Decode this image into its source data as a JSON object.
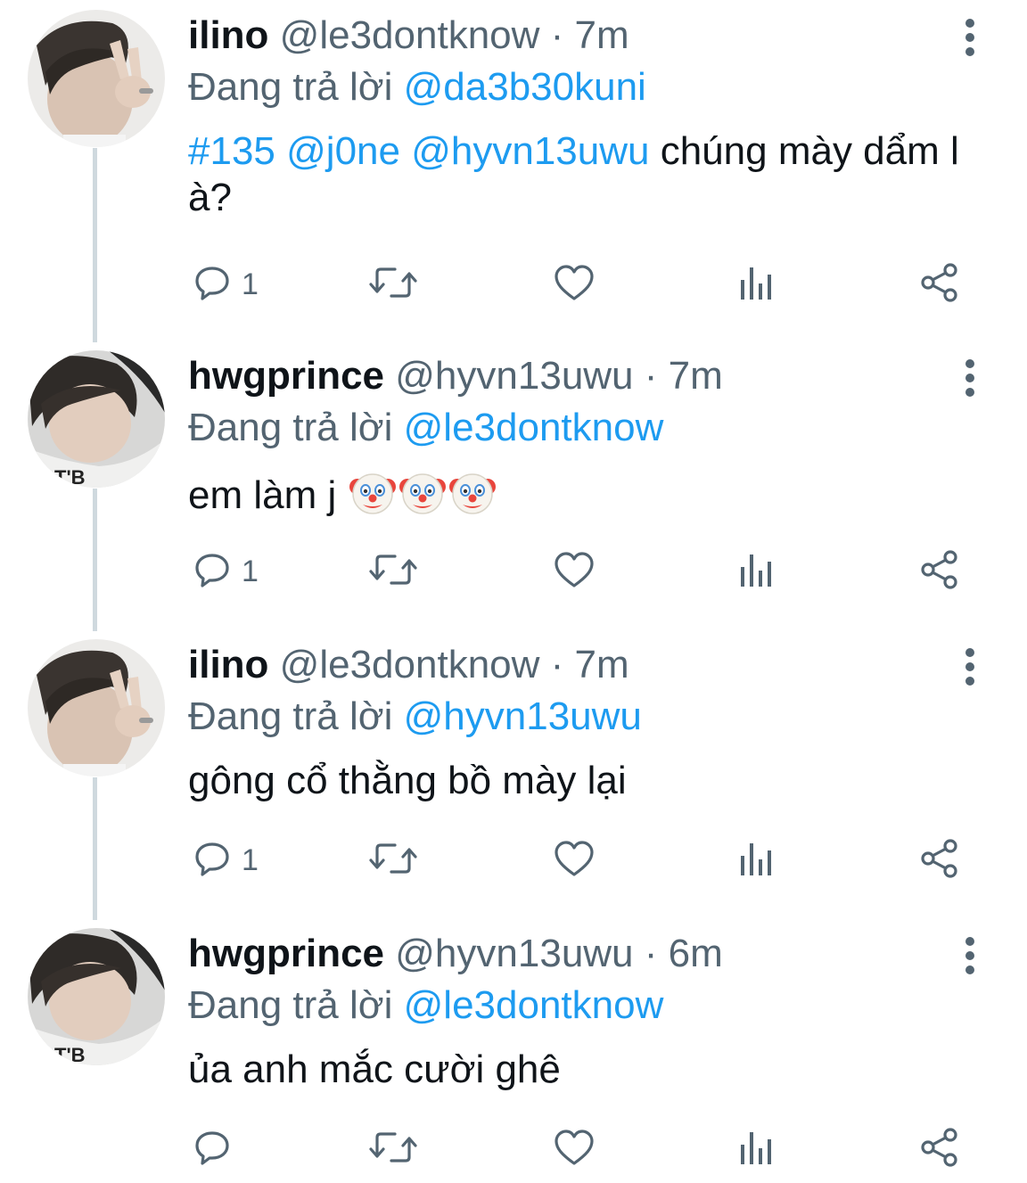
{
  "colors": {
    "link": "#1d9bf0",
    "secondary": "#536471",
    "text": "#0f1419",
    "thread_line": "#cfd9de"
  },
  "tweets": [
    {
      "name": "ilino",
      "handle": "@le3dontknow",
      "time": "· 7m",
      "reply_prefix": "Đang trả lời",
      "reply_to": "@da3b30kuni",
      "body_parts": [
        {
          "text": "#135",
          "link": true
        },
        {
          "text": " ",
          "link": false
        },
        {
          "text": "@j0ne",
          "link": true
        },
        {
          "text": " ",
          "link": false
        },
        {
          "text": "@hyvn13uwu",
          "link": true
        },
        {
          "text": " chúng mày dẩm l à?",
          "link": false
        }
      ],
      "reply_count": "1",
      "avatar_icon": "avatar-ilino"
    },
    {
      "name": "hwgprince",
      "handle": "@hyvn13uwu",
      "time": "· 7m",
      "reply_prefix": "Đang trả lời",
      "reply_to": "@le3dontknow",
      "body_parts": [
        {
          "text": "em làm j ",
          "link": false
        }
      ],
      "emoji": [
        "clown-face-emoji",
        "clown-face-emoji",
        "clown-face-emoji"
      ],
      "reply_count": "1",
      "avatar_icon": "avatar-hwgprince"
    },
    {
      "name": "ilino",
      "handle": "@le3dontknow",
      "time": "· 7m",
      "reply_prefix": "Đang trả lời",
      "reply_to": "@hyvn13uwu",
      "body_parts": [
        {
          "text": "gông cổ thằng bồ mày lại",
          "link": false
        }
      ],
      "reply_count": "1",
      "avatar_icon": "avatar-ilino"
    },
    {
      "name": "hwgprince",
      "handle": "@hyvn13uwu",
      "time": "· 6m",
      "reply_prefix": "Đang trả lời",
      "reply_to": "@le3dontknow",
      "body_parts": [
        {
          "text": "ủa anh mắc cười ghê",
          "link": false
        }
      ],
      "reply_count": "",
      "avatar_icon": "avatar-hwgprince"
    }
  ],
  "action_icons": [
    "reply-icon",
    "retweet-icon",
    "like-icon",
    "views-icon",
    "share-icon"
  ]
}
